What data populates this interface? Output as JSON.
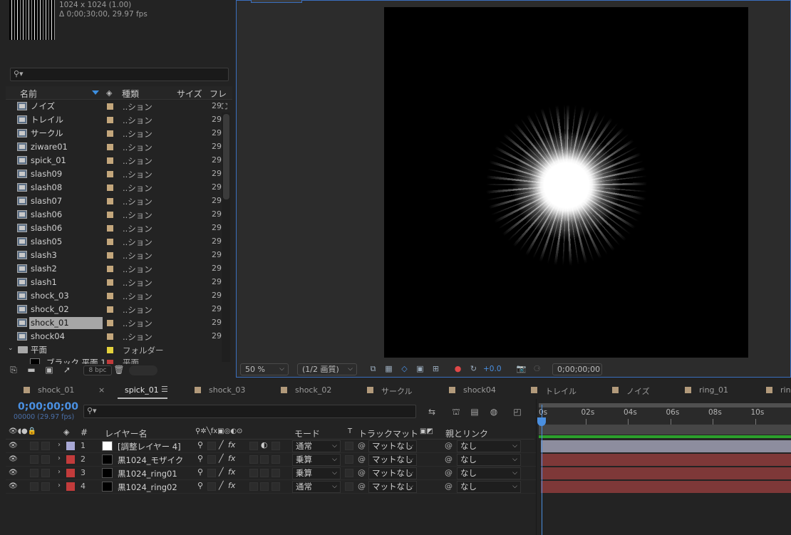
{
  "project": {
    "dimensions": "1024 x 1024 (1.00)",
    "timing": "Δ 0;00;30;00, 29.97 fps",
    "search_placeholder": "",
    "columns": {
      "name": "名前",
      "type": "種類",
      "size": "サイズ",
      "frame": "フレ"
    },
    "items": [
      {
        "name": "ノイズ",
        "type": "..ション",
        "frame": "29"
      },
      {
        "name": "トレイル",
        "type": "..ション",
        "frame": "29"
      },
      {
        "name": "サークル",
        "type": "..ション",
        "frame": "29"
      },
      {
        "name": "ziware01",
        "type": "..ション",
        "frame": "29"
      },
      {
        "name": "spick_01",
        "type": "..ション",
        "frame": "29"
      },
      {
        "name": "slash09",
        "type": "..ション",
        "frame": "29"
      },
      {
        "name": "slash08",
        "type": "..ション",
        "frame": "29"
      },
      {
        "name": "slash07",
        "type": "..ション",
        "frame": "29"
      },
      {
        "name": "slash06",
        "type": "..ション",
        "frame": "29"
      },
      {
        "name": "slash06",
        "type": "..ション",
        "frame": "29"
      },
      {
        "name": "slash05",
        "type": "..ション",
        "frame": "29"
      },
      {
        "name": "slash3",
        "type": "..ション",
        "frame": "29"
      },
      {
        "name": "slash2",
        "type": "..ション",
        "frame": "29"
      },
      {
        "name": "slash1",
        "type": "..ション",
        "frame": "29"
      },
      {
        "name": "shock_03",
        "type": "..ション",
        "frame": "29"
      },
      {
        "name": "shock_02",
        "type": "..ション",
        "frame": "29"
      },
      {
        "name": "shock_01",
        "type": "..ション",
        "frame": "29",
        "selected": true
      },
      {
        "name": "shock04",
        "type": "..ション",
        "frame": "29"
      }
    ],
    "folder": {
      "name": "平面",
      "type": "フォルダー"
    },
    "partial_item": "ブラック 平面 1",
    "partial_type": "平面",
    "bpc": "8 bpc"
  },
  "viewer": {
    "zoom": "50 %",
    "resolution": "(1/2 画質)",
    "exposure": "+0.0",
    "timecode": "0;00;00;00"
  },
  "tabs": [
    {
      "label": "shock_01",
      "color": "#b29a7b"
    },
    {
      "label": "spick_01",
      "active": true
    },
    {
      "label": "shock_03",
      "color": "#b29a7b"
    },
    {
      "label": "shock_02",
      "color": "#b29a7b"
    },
    {
      "label": "サークル",
      "color": "#b29a7b"
    },
    {
      "label": "shock04",
      "color": "#b29a7b"
    },
    {
      "label": "トレイル",
      "color": "#b29a7b"
    },
    {
      "label": "ノイズ",
      "color": "#b29a7b"
    },
    {
      "label": "ring_01",
      "color": "#b29a7b"
    },
    {
      "label": "ring",
      "color": "#b29a7b"
    }
  ],
  "timeline": {
    "timecode": "0;00;00;00",
    "frame_info": "00000 (29.97 fps)",
    "headers": {
      "hash": "#",
      "layer_name": "レイヤー名",
      "mode": "モード",
      "t": "T",
      "track_matte": "トラックマット",
      "parent": "親とリンク"
    },
    "ticks": [
      "0s",
      "02s",
      "04s",
      "06s",
      "08s",
      "10s"
    ],
    "layers": [
      {
        "num": "1",
        "label_color": "#a9a9d6",
        "comp_color": "#ffffff",
        "name": "[調整レイヤー 4]",
        "mode": "通常",
        "matte": "マットなし",
        "parent": "なし",
        "bar_color": "#8d8d9e"
      },
      {
        "num": "2",
        "label_color": "#c23b3b",
        "comp_color": "#000000",
        "name": "黒1024_モザイク",
        "mode": "乗算",
        "matte": "マットなし",
        "parent": "なし",
        "bar_color": "#7e3838"
      },
      {
        "num": "3",
        "label_color": "#c23b3b",
        "comp_color": "#000000",
        "name": "黒1024_ring01",
        "mode": "乗算",
        "matte": "マットなし",
        "parent": "なし",
        "bar_color": "#7e3838"
      },
      {
        "num": "4",
        "label_color": "#c23b3b",
        "comp_color": "#000000",
        "name": "黒1024_ring02",
        "mode": "通常",
        "matte": "マットなし",
        "parent": "なし",
        "bar_color": "#7e3838"
      }
    ]
  }
}
